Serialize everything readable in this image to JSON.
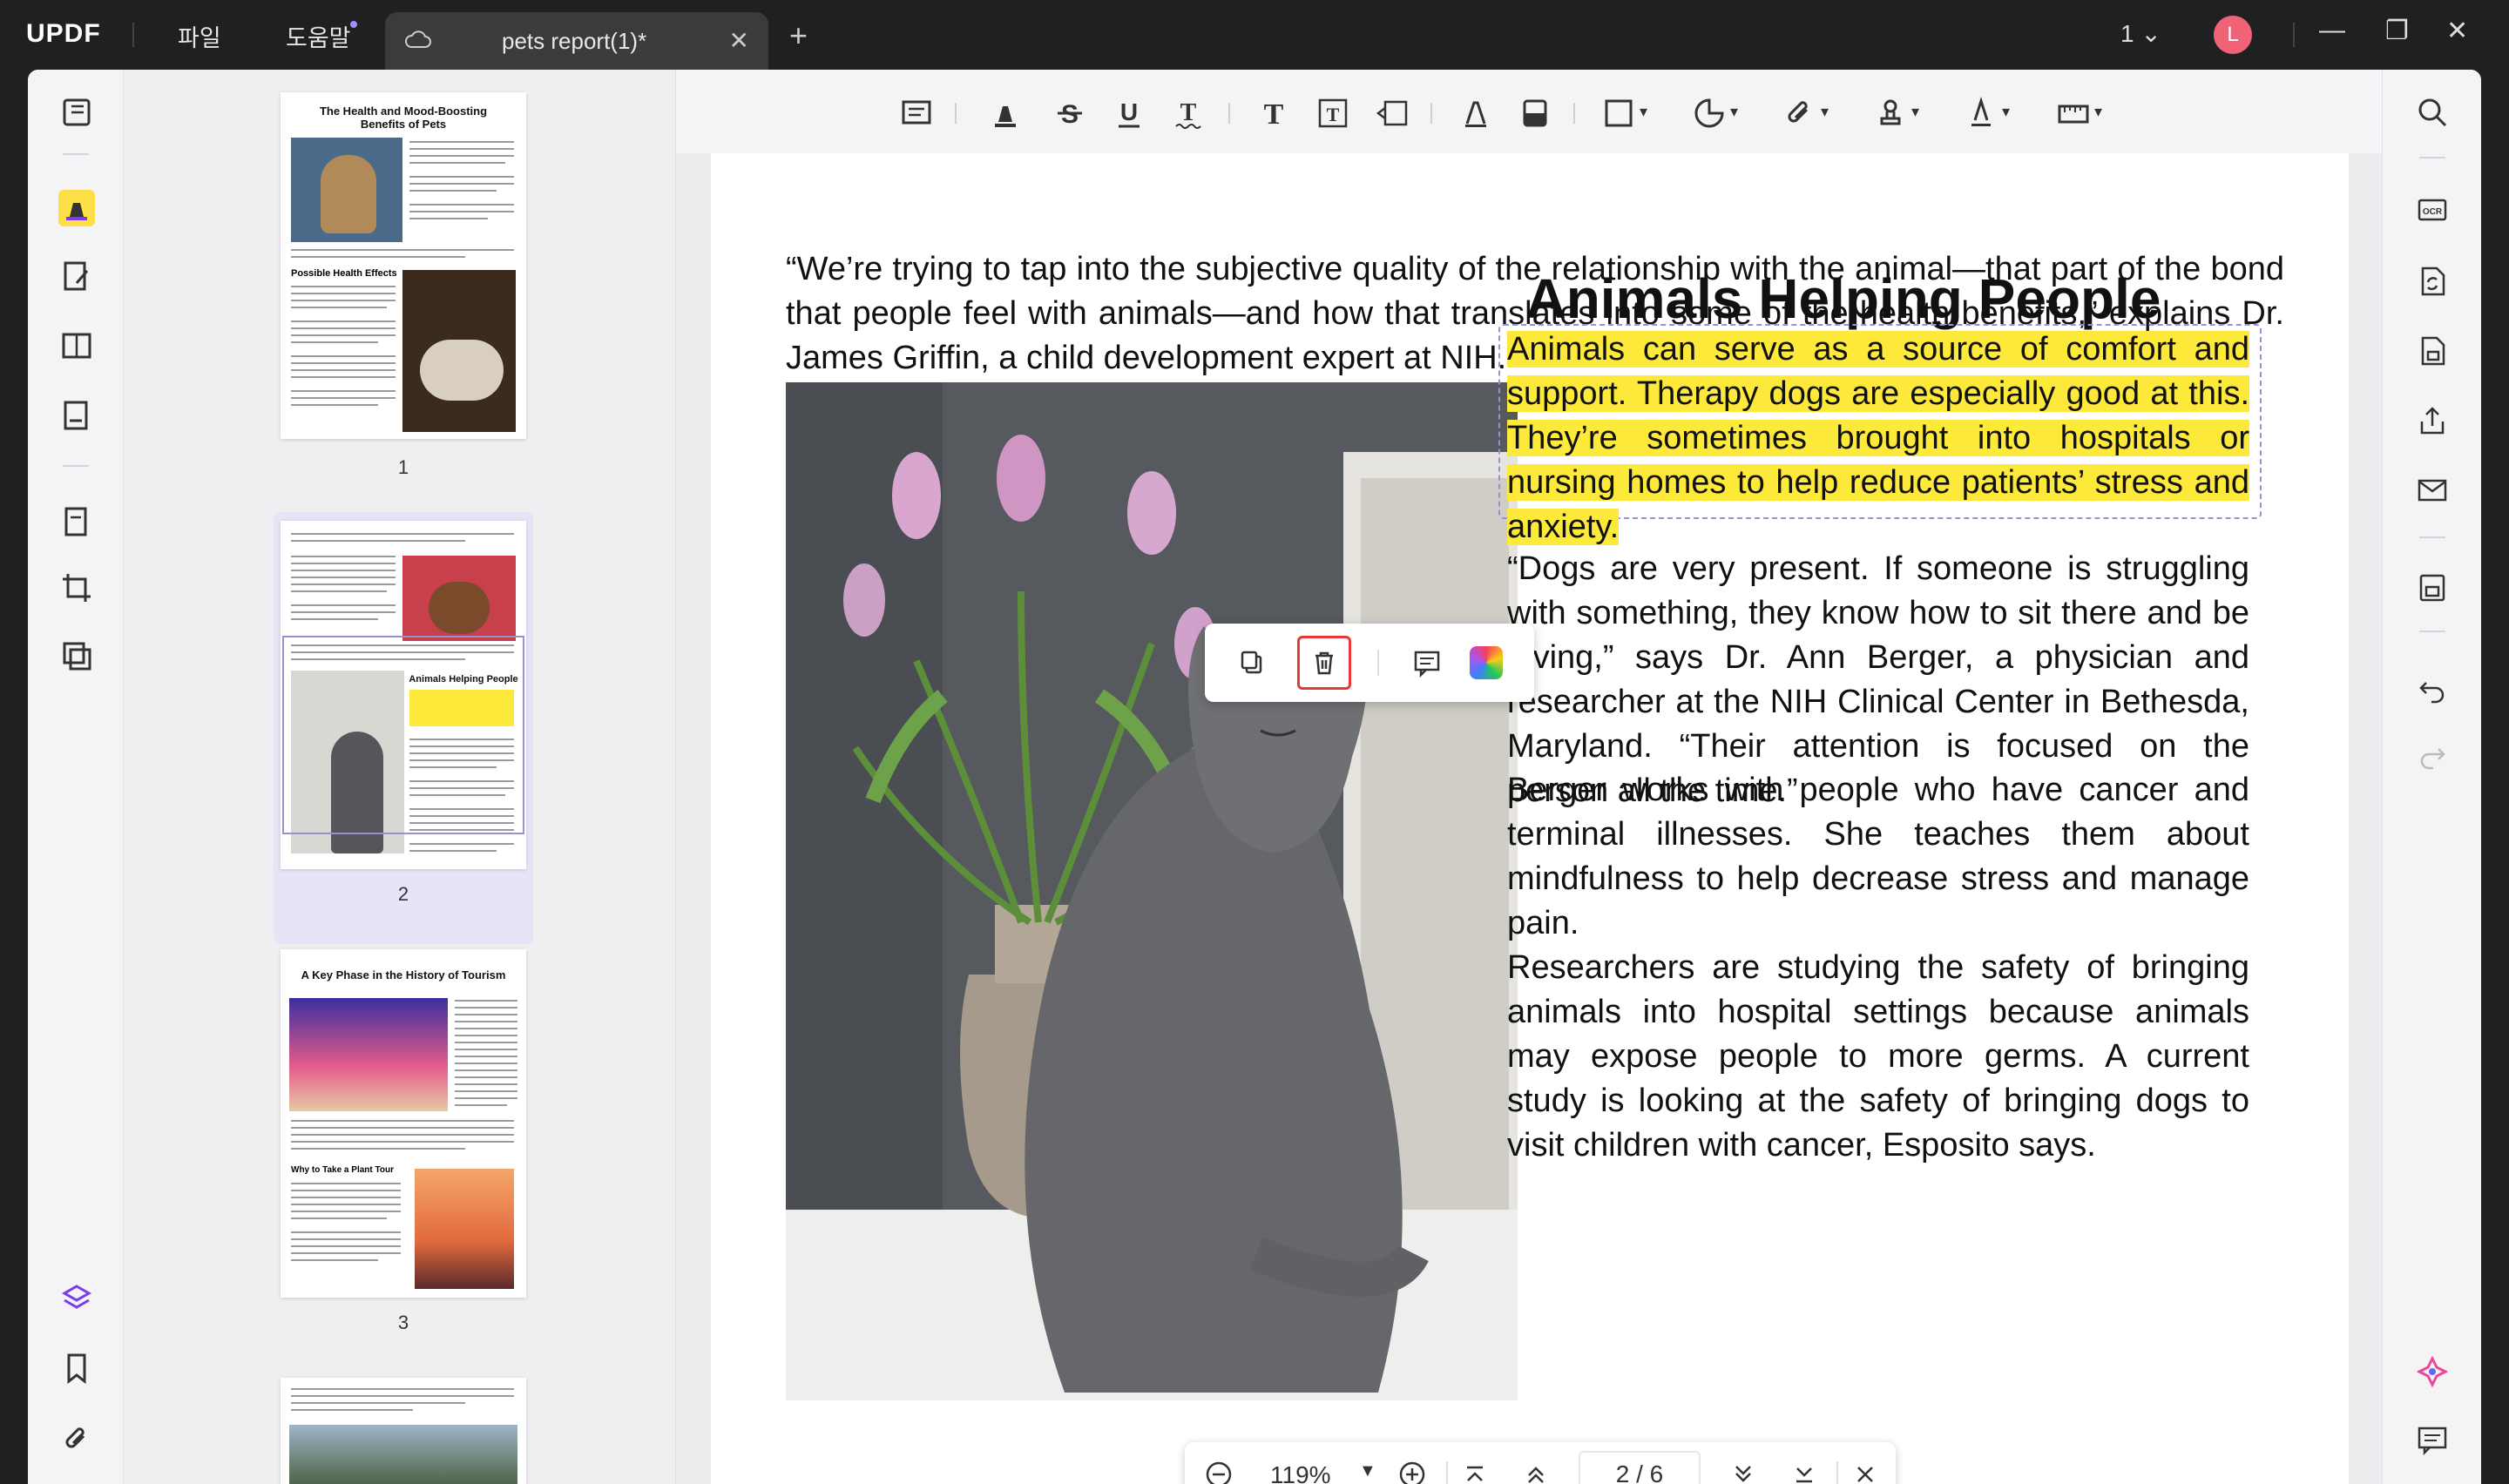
{
  "app": {
    "logo": "UPDF",
    "menu": [
      "파일",
      "도움말"
    ],
    "tab_title": "pets report(1)*",
    "window_count": "1",
    "avatar_letter": "L"
  },
  "thumbnails": [
    {
      "page": "1",
      "title": "The Health and Mood-Boosting Benefits of Pets",
      "section": "Possible Health Effects"
    },
    {
      "page": "2",
      "title": "Animals Helping People"
    },
    {
      "page": "3",
      "title": "A Key Phase in the History of Tourism",
      "section": "Why to Take a Plant Tour"
    }
  ],
  "document": {
    "intro": "“We’re trying to tap into the subjective quality of the relationship with the animal—that part of the bond that people feel with animals—and how that translates into some of the health benefits,” explains Dr. James Griffin, a child development expert at NIH.",
    "heading": "Animals Helping People",
    "highlighted": "Animals can serve as a source of comfort and support. Therapy dogs are especially good at this. They’re sometimes brought into hospitals or nursing homes to help reduce patients’ stress and anxiety.",
    "para2": "“Dogs are very present. If someone is struggling with something, they know how to sit there and be loving,” says Dr. Ann Berger, a physician and researcher at the NIH Clinical Center in Bethesda, Maryland. “Their attention is focused on the person all the time.”",
    "para3": "Berger works with people who have cancer and terminal illnesses. She teaches them about mindfulness to help decrease stress and manage pain.",
    "para4": "Researchers are studying the safety of bringing animals into hospital settings because animals may expose people to more germs. A current study is looking at the safety of bringing dogs to visit children with cancer, Esposito says."
  },
  "zoom": {
    "level": "119%",
    "current_page": "2",
    "separator": "/",
    "total_pages": "6"
  },
  "colors": {
    "highlight": "#fce93a",
    "accent": "#a78bfa",
    "danger": "#e53935"
  }
}
